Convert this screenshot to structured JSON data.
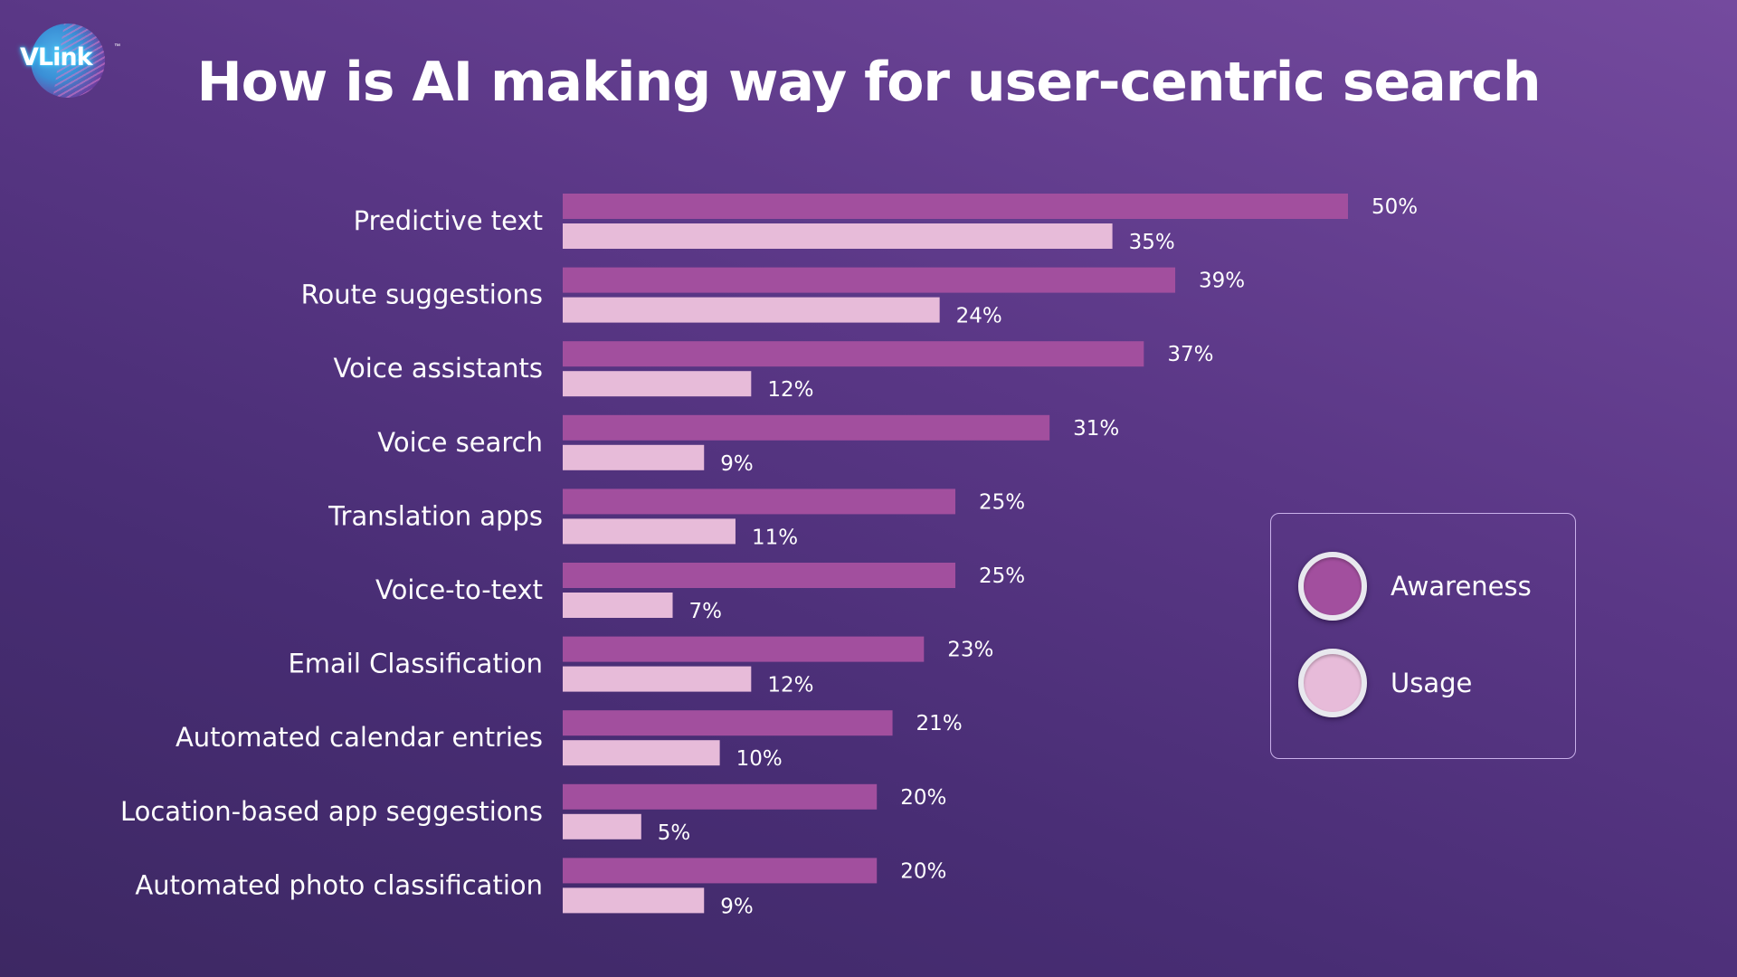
{
  "logo": {
    "text": "VLink",
    "tm": "™"
  },
  "colors": {
    "awareness": "#a24f9e",
    "usage": "#e7bbd9",
    "background_top_right": "#70479a",
    "background_bottom_left": "#3d2863"
  },
  "chart_data": {
    "type": "bar",
    "orientation": "horizontal",
    "title": "How is AI making way for user-centric search",
    "xlabel": "",
    "ylabel": "",
    "unit": "%",
    "xlim": [
      0,
      50
    ],
    "grid": false,
    "legend_position": "right",
    "categories": [
      "Predictive text",
      "Route suggestions",
      "Voice assistants",
      "Voice search",
      "Translation apps",
      "Voice-to-text",
      "Email Classification",
      "Automated calendar entries",
      "Location-based app seggestions",
      "Automated photo classification"
    ],
    "series": [
      {
        "name": "Awareness",
        "color": "#a24f9e",
        "values": [
          50,
          39,
          37,
          31,
          25,
          25,
          23,
          21,
          20,
          20
        ]
      },
      {
        "name": "Usage",
        "color": "#e7bbd9",
        "values": [
          35,
          24,
          12,
          9,
          11,
          7,
          12,
          10,
          5,
          9
        ]
      }
    ]
  }
}
